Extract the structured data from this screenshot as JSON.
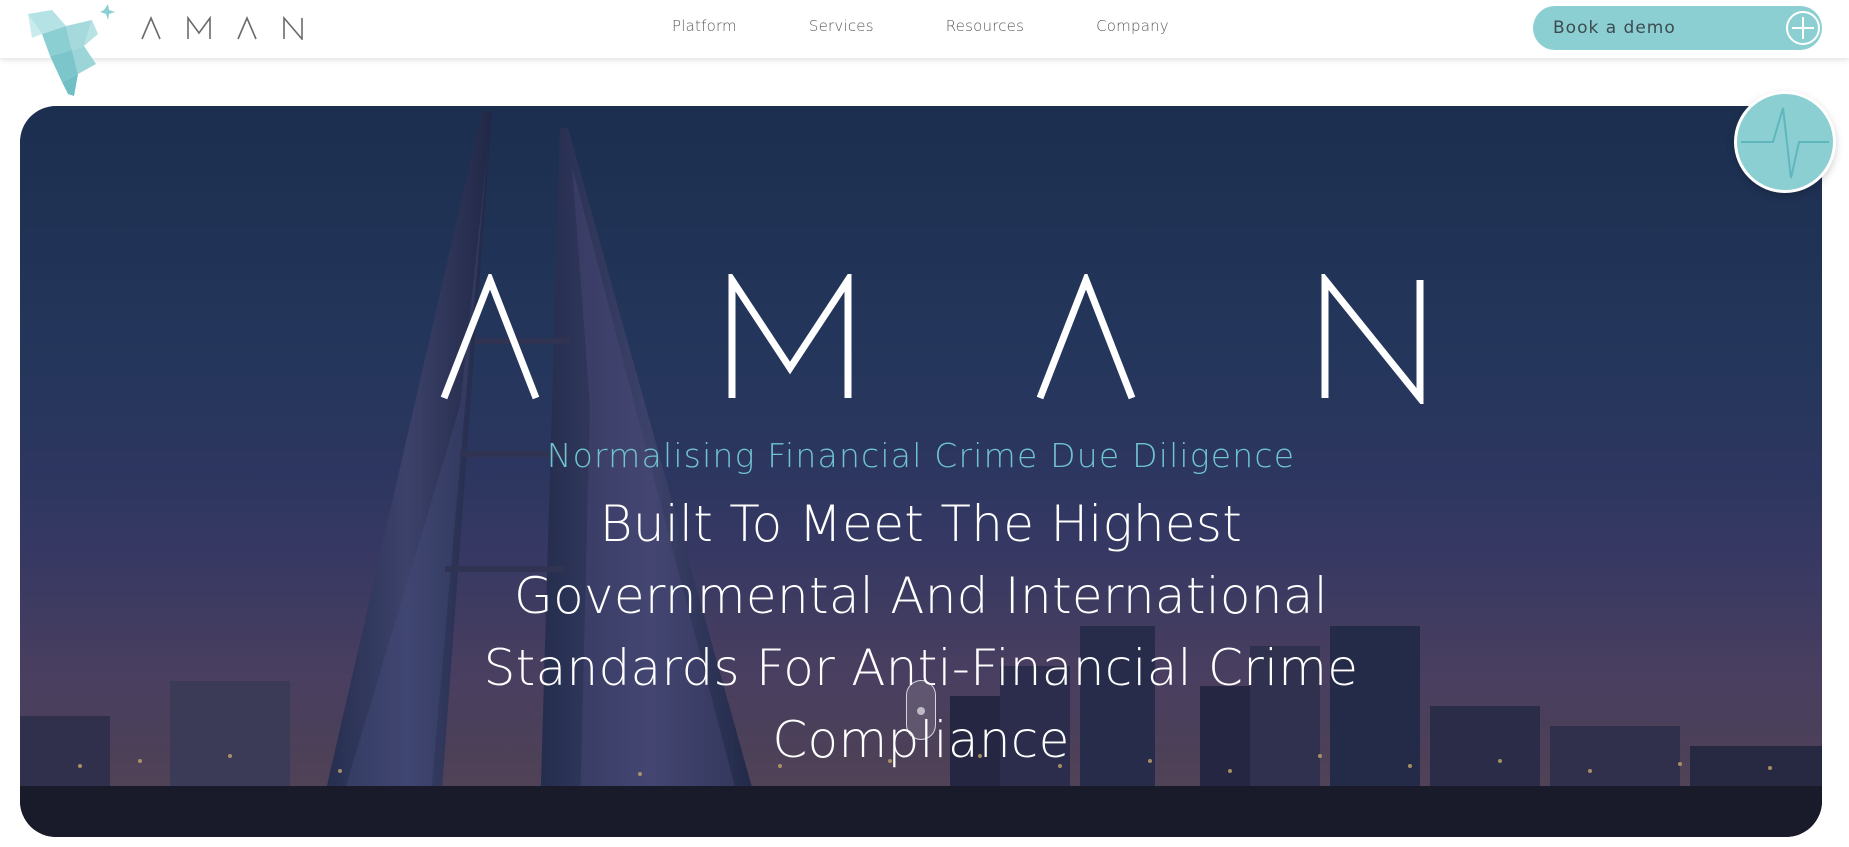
{
  "header": {
    "brand": "AMAN",
    "nav": [
      {
        "label": "Platform"
      },
      {
        "label": "Services"
      },
      {
        "label": "Resources"
      },
      {
        "label": "Company"
      }
    ],
    "cta_label": "Book a demo"
  },
  "hero": {
    "brand": "AMAN",
    "tagline": "Normalising Financial Crime Due Diligence",
    "headline": "Built To Meet The Highest Governmental And International Standards For Anti-Financial Crime Compliance"
  },
  "icons": {
    "logo": "origami-bird-logo",
    "cta": "plus-circle-icon",
    "badge": "heartbeat-pulse-icon",
    "scroll": "scroll-mouse-icon"
  },
  "colors": {
    "accent": "#8ccfd3",
    "tagline": "#6fc4cf",
    "nav_text": "#5b5b5b",
    "hero_text": "#ffffff"
  }
}
